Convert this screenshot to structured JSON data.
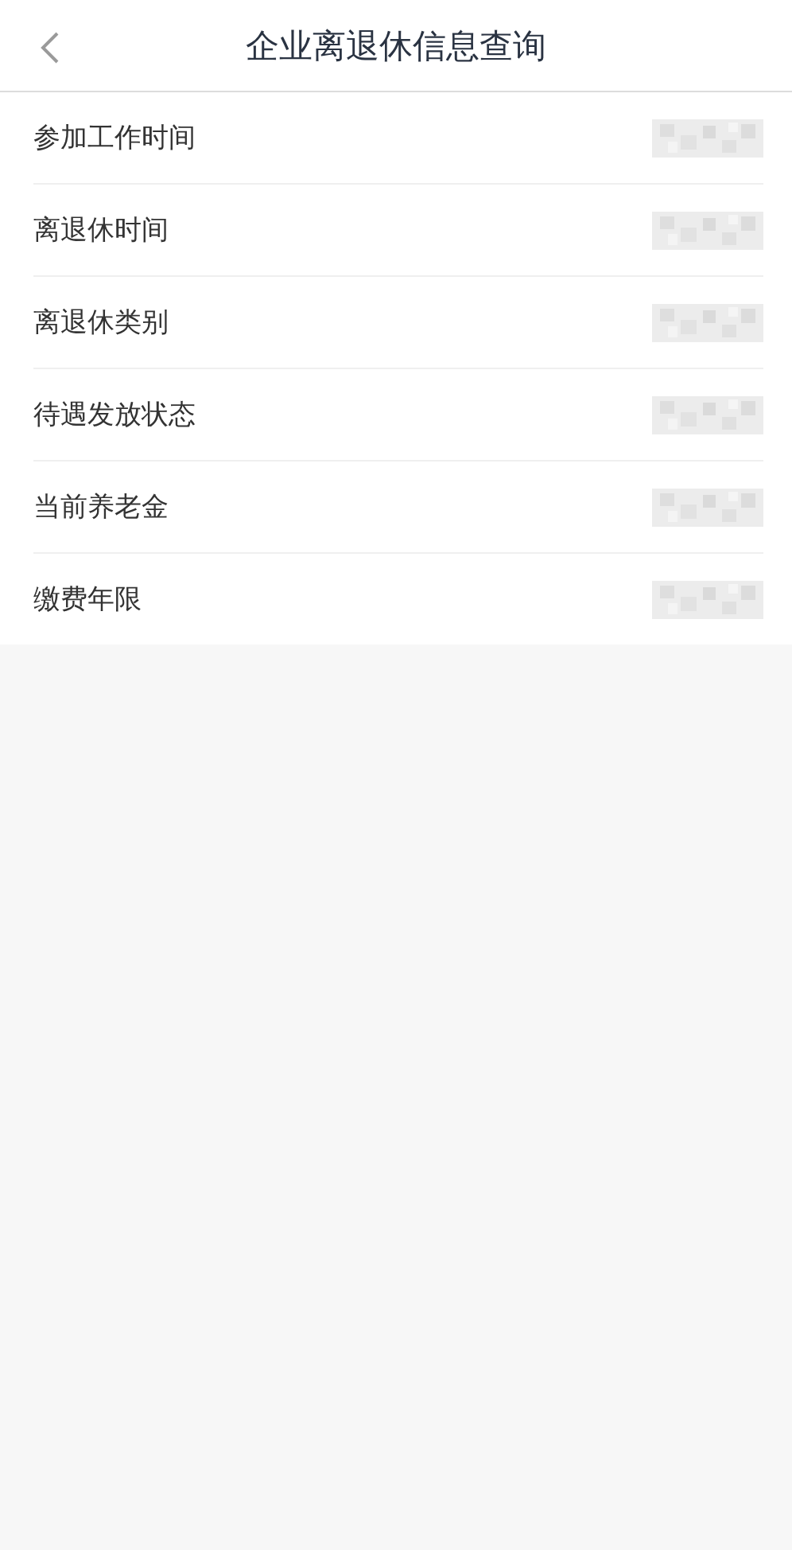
{
  "header": {
    "title": "企业离退休信息查询"
  },
  "rows": [
    {
      "label": "参加工作时间"
    },
    {
      "label": "离退休时间"
    },
    {
      "label": "离退休类别"
    },
    {
      "label": "待遇发放状态"
    },
    {
      "label": "当前养老金"
    },
    {
      "label": "缴费年限"
    }
  ]
}
